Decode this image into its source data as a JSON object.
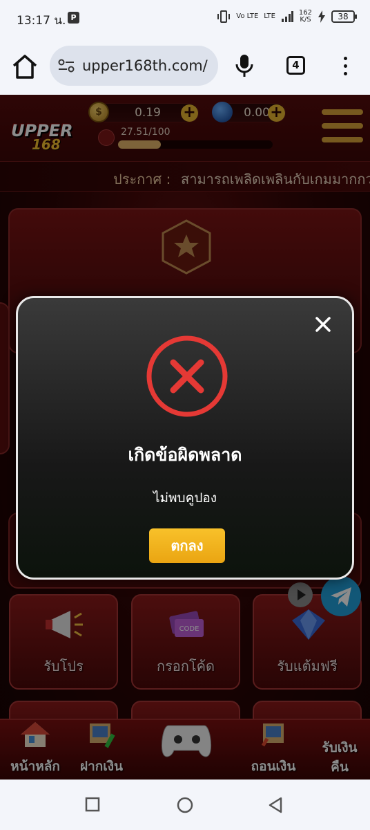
{
  "status_bar": {
    "time": "13:17 น.",
    "net_speed_value": "162",
    "net_speed_unit": "K/S",
    "network_1": "Vo LTE",
    "network_2": "LTE",
    "battery": "38"
  },
  "browser": {
    "url": "upper168th.com/",
    "tab_count": "4"
  },
  "site": {
    "logo_top": "UPPER",
    "logo_bottom": "168",
    "coin_balance": "0.19",
    "gem_balance": "0.00",
    "exp_text": "27.51/100",
    "exp_progress": 0.2751,
    "announcement_label": "ประกาศ :",
    "announcement_text": "สามารถเพลิดเพลินกับเกมมากกว่า",
    "tiles": [
      {
        "label": "รับโปร"
      },
      {
        "label": "กรอกโค้ด"
      },
      {
        "label": "รับแต้มฟรี"
      }
    ],
    "bottom_nav": {
      "home": "หน้าหลัก",
      "deposit": "ฝากเงิน",
      "withdraw": "ถอนเงิน",
      "cashback_1": "รับเงิน",
      "cashback_2": "คืน"
    }
  },
  "modal": {
    "title": "เกิดข้อผิดพลาด",
    "message": "ไม่พบคูปอง",
    "ok_label": "ตกลง",
    "error_color": "#e53935"
  }
}
